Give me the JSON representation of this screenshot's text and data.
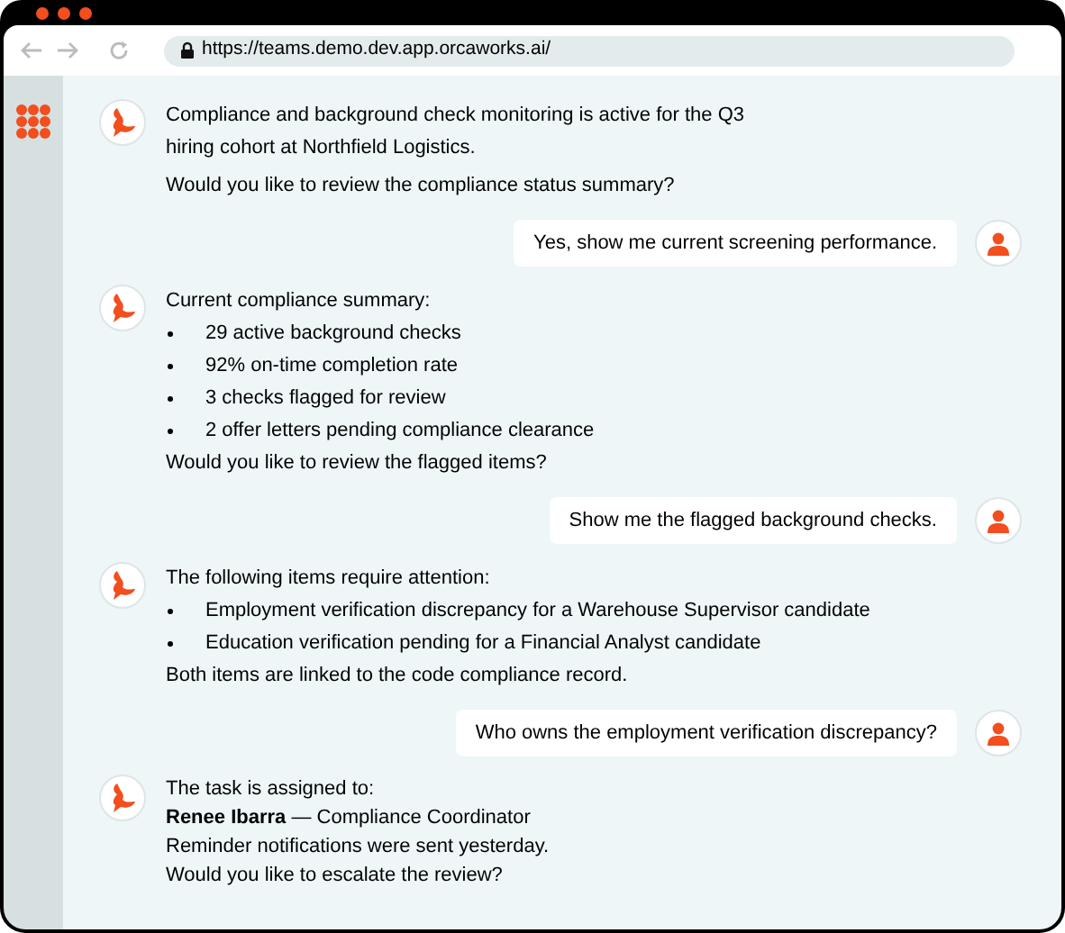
{
  "browser": {
    "url": "https://teams.demo.dev.app.orcaworks.ai/"
  },
  "messages": [
    {
      "kind": "bot",
      "lines": [
        {
          "kind": "text",
          "text": "Compliance and background check monitoring is active for the Q3"
        },
        {
          "kind": "text",
          "text": "hiring cohort at Northfield Logistics."
        },
        {
          "kind": "gap"
        },
        {
          "kind": "text",
          "text": "Would you like to review the compliance status summary?"
        }
      ]
    },
    {
      "kind": "user",
      "text": "Yes, show me current screening performance."
    },
    {
      "kind": "bot",
      "lines": [
        {
          "kind": "text",
          "text": "Current compliance summary:"
        },
        {
          "kind": "bullet",
          "text": "29 active background checks"
        },
        {
          "kind": "bullet",
          "text": "92% on-time completion rate"
        },
        {
          "kind": "bullet",
          "text": "3 checks flagged for review"
        },
        {
          "kind": "bullet",
          "text": "2 offer letters pending compliance clearance"
        },
        {
          "kind": "text",
          "text": "Would you like to review the flagged items?"
        }
      ]
    },
    {
      "kind": "user",
      "text": "Show me the flagged background checks."
    },
    {
      "kind": "bot",
      "lines": [
        {
          "kind": "text",
          "text": "The following items require attention:"
        },
        {
          "kind": "bullet",
          "text": "Employment verification discrepancy for a Warehouse Supervisor candidate"
        },
        {
          "kind": "bullet",
          "text": "Education verification pending for a Financial Analyst candidate"
        },
        {
          "kind": "text",
          "text": "Both items are linked to the code compliance record."
        }
      ]
    },
    {
      "kind": "user",
      "text": "Who owns the employment verification discrepancy?"
    },
    {
      "kind": "bot",
      "lines": [
        {
          "kind": "tight",
          "text": "The task is assigned to:"
        },
        {
          "kind": "tight",
          "text": "**Renee Ibarra** — Compliance Coordinator"
        },
        {
          "kind": "tight",
          "text": "Reminder notifications were sent yesterday."
        },
        {
          "kind": "tight",
          "text": "Would you like to escalate the review?"
        }
      ]
    }
  ]
}
